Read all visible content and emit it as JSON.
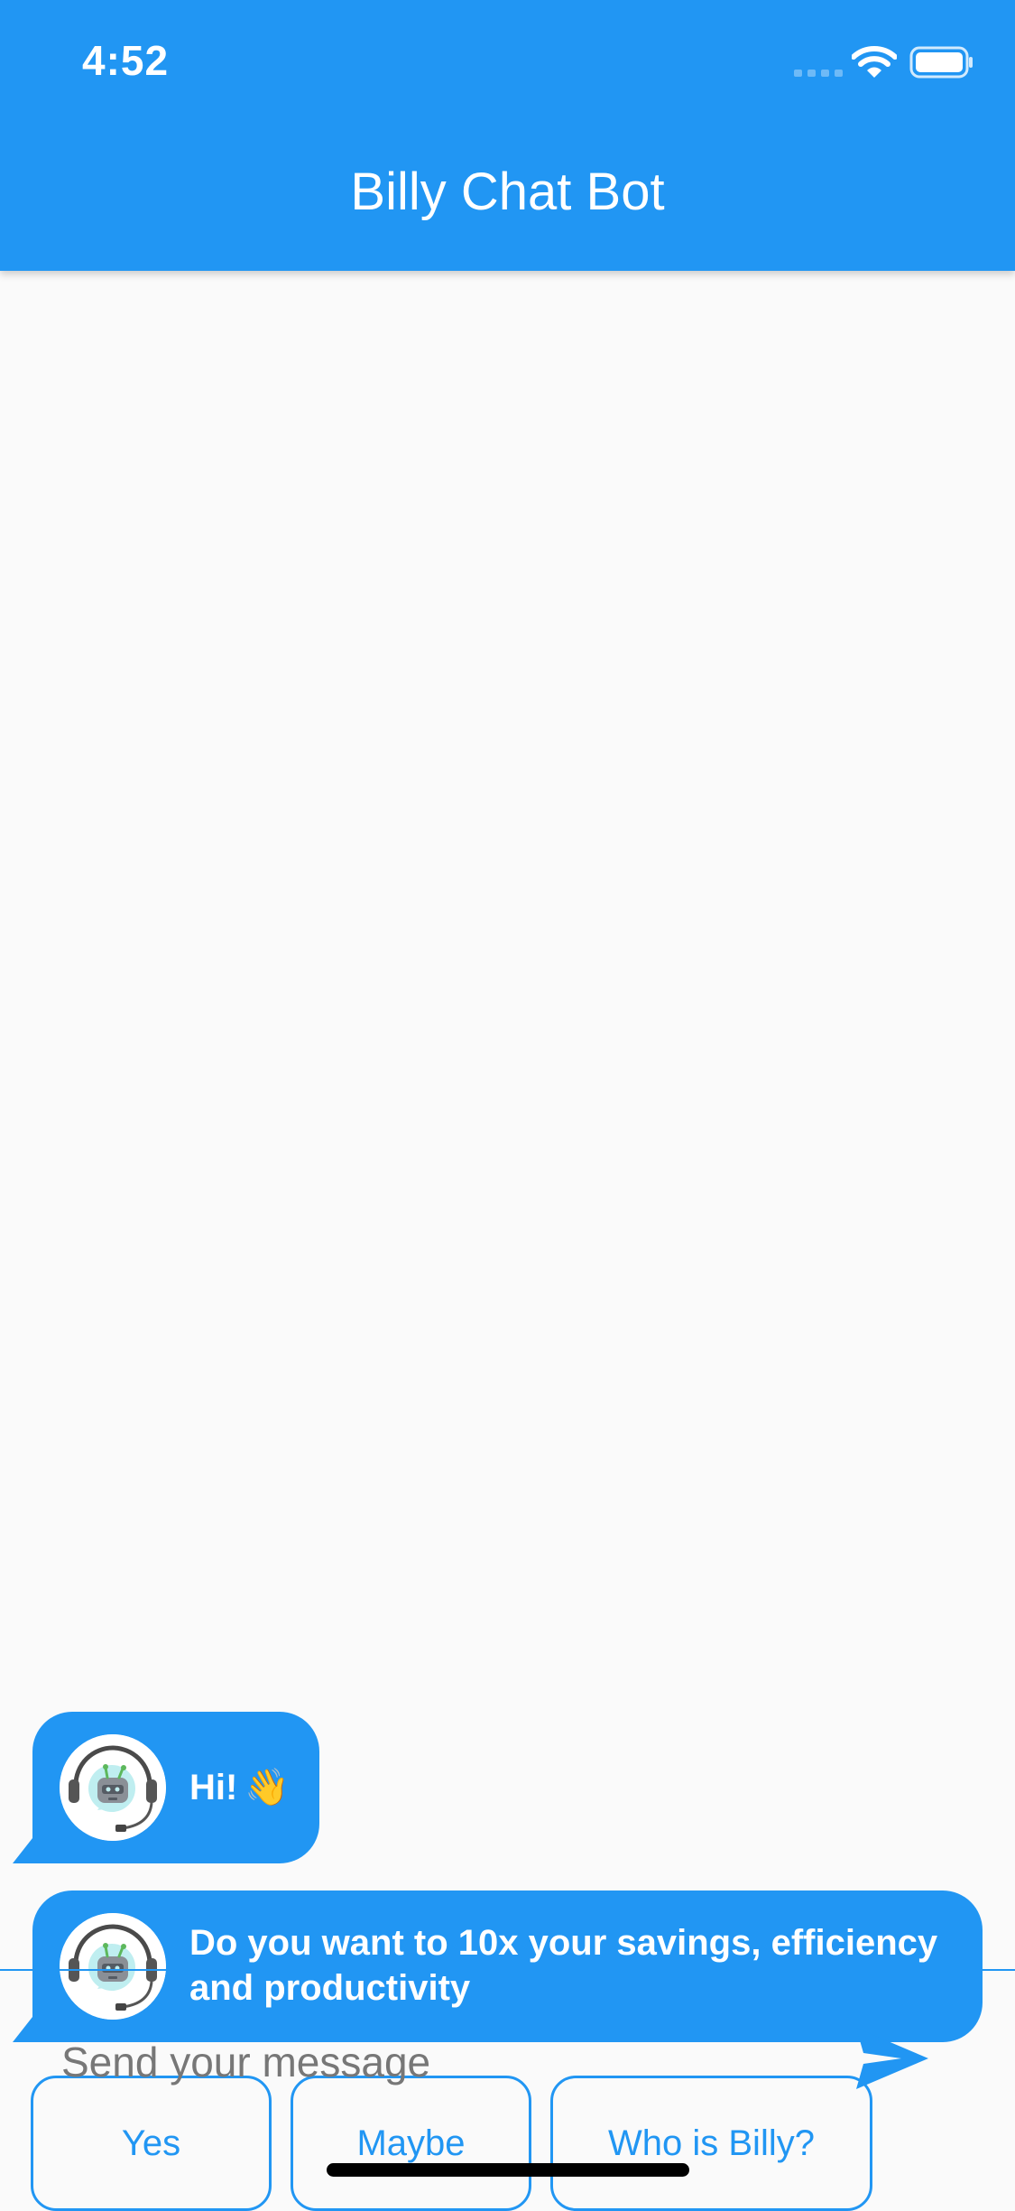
{
  "status_bar": {
    "time": "4:52",
    "icons": [
      "cellular-signal-icon",
      "wifi-icon",
      "battery-icon"
    ]
  },
  "app_bar": {
    "title": "Billy Chat Bot",
    "color": "#2196f3"
  },
  "messages": [
    {
      "sender": "bot",
      "avatar_icon": "robot-support-avatar-icon",
      "text": "Hi!",
      "emoji": "👋"
    },
    {
      "sender": "bot",
      "avatar_icon": "robot-support-avatar-icon",
      "text": "Do you want to 10x your savings, efficiency and productivity"
    }
  ],
  "suggestions": [
    {
      "label": "Yes"
    },
    {
      "label": "Maybe"
    },
    {
      "label": "Who is Billy?"
    }
  ],
  "input": {
    "value": "",
    "placeholder": "Send your message"
  },
  "send_icon": "send-icon",
  "colors": {
    "accent": "#2196f3",
    "background": "#fafafa",
    "bubble_text": "#ffffff"
  }
}
